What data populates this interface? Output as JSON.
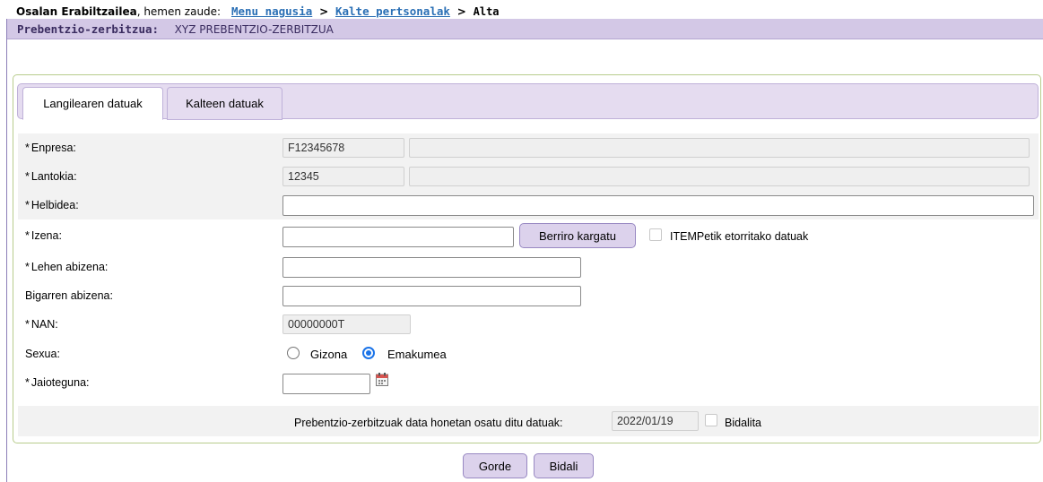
{
  "breadcrumb": {
    "user_name": "Osalan Erabiltzailea",
    "location_text": ", hemen zaude:",
    "links": [
      "Menu nagusia",
      "Kalte pertsonalak"
    ],
    "separator": ">",
    "current": "Alta"
  },
  "service": {
    "label": "Prebentzio-zerbitzua:",
    "value": "XYZ PREBENTZIO-ZERBITZUA"
  },
  "tabs": [
    {
      "label": "Langilearen datuak",
      "active": true
    },
    {
      "label": "Kalteen datuak",
      "active": false
    }
  ],
  "required_mark": "*",
  "form": {
    "enpresa": {
      "label": "Enpresa:",
      "code": "F12345678",
      "name": ""
    },
    "lantokia": {
      "label": "Lantokia:",
      "code": "12345",
      "name": ""
    },
    "helbidea": {
      "label": "Helbidea:",
      "value": ""
    },
    "izena": {
      "label": "Izena:",
      "value": "",
      "reload_button": "Berriro kargatu",
      "itemp_checkbox_label": "ITEMPetik etorritako datuak",
      "itemp_checked": false
    },
    "lehen_abizena": {
      "label": "Lehen abizena:",
      "value": ""
    },
    "bigarren_abizena": {
      "label": "Bigarren abizena:",
      "value": ""
    },
    "nan": {
      "label": "NAN:",
      "value": "00000000T"
    },
    "sexua": {
      "label": "Sexua:",
      "options": [
        "Gizona",
        "Emakumea"
      ],
      "selected": "Emakumea"
    },
    "jaioteguna": {
      "label": "Jaioteguna:",
      "value": "",
      "calendar_icon": "calendar-icon"
    }
  },
  "footer_row": {
    "text": "Prebentzio-zerbitzuak data honetan osatu ditu datuak:",
    "date": "2022/01/19",
    "sent_label": "Bidalita",
    "sent_checked": false
  },
  "actions": {
    "save": "Gorde",
    "send": "Bidali"
  },
  "colors": {
    "service_bar": "#d3c8e6",
    "tab_bar": "#e5dcf0",
    "panel_border": "#b8cc8c",
    "link": "#2a6fb5",
    "button": "#dcd2ec"
  }
}
